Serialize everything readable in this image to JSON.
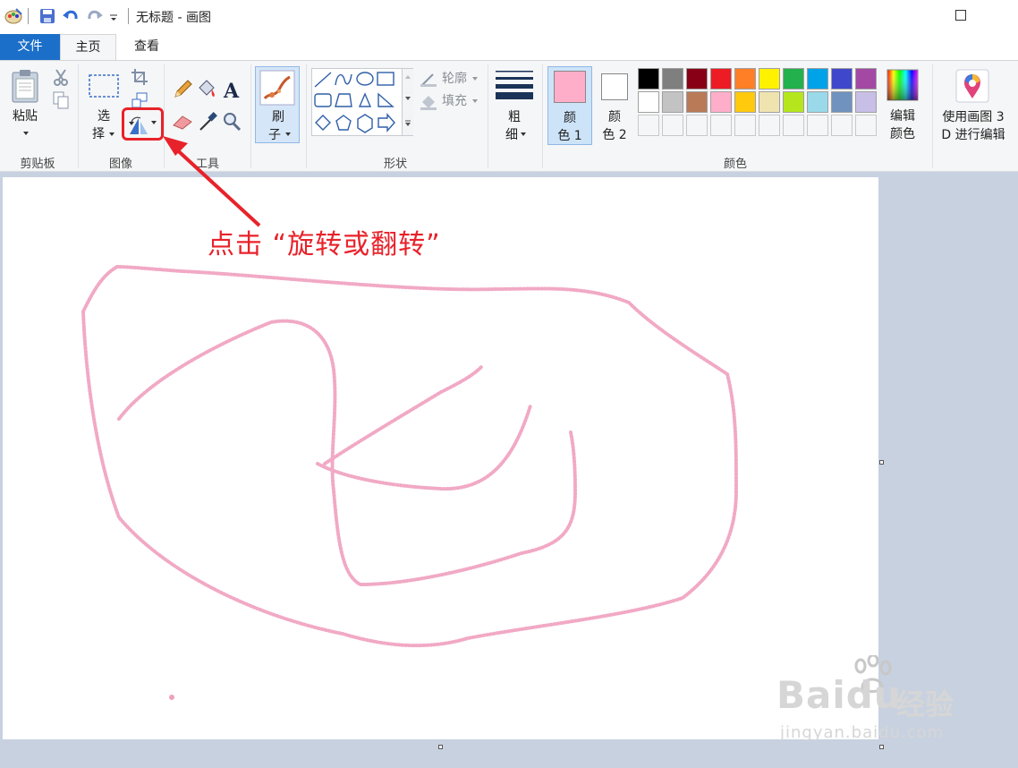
{
  "titlebar": {
    "title": "无标题 - 画图",
    "icons": [
      "paint-app-icon",
      "save-icon",
      "undo-icon",
      "redo-icon",
      "customize-qat-icon",
      "maximize-icon"
    ]
  },
  "tabs": [
    {
      "label": "文件",
      "active": false
    },
    {
      "label": "主页",
      "active": true
    },
    {
      "label": "查看",
      "active": false
    }
  ],
  "ribbon": {
    "clipboard": {
      "paste_label": "粘贴",
      "group_label": "剪贴板",
      "icons": [
        "paste-icon",
        "cut-icon",
        "copy-icon"
      ]
    },
    "image": {
      "select_label_1": "选",
      "select_label_2": "择",
      "group_label": "图像",
      "icons": [
        "select-icon",
        "crop-icon",
        "resize-icon",
        "rotate-icon"
      ]
    },
    "tools": {
      "group_label": "工具",
      "icons": [
        "pencil-icon",
        "fill-icon",
        "text-icon",
        "eraser-icon",
        "color-picker-icon",
        "magnifier-icon"
      ]
    },
    "brushes": {
      "label_1": "刷",
      "label_2": "子"
    },
    "shapes": {
      "group_label": "形状",
      "outline_label": "轮廓",
      "fill_label": "填充"
    },
    "size": {
      "label_1": "粗",
      "label_2": "细"
    },
    "colors": {
      "color1_label_1": "颜",
      "color1_label_2": "色 1",
      "color2_label_1": "颜",
      "color2_label_2": "色 2",
      "edit_label_1": "编辑",
      "edit_label_2": "颜色",
      "group_label": "颜色",
      "color1_value": "#ffaec9",
      "color2_value": "#ffffff",
      "palette_row1": [
        "#000000",
        "#7f7f7f",
        "#880015",
        "#ed1c24",
        "#ff7f27",
        "#fff200",
        "#22b14c",
        "#00a2e8",
        "#3f48cc",
        "#a349a4"
      ],
      "palette_row2": [
        "#ffffff",
        "#c3c3c3",
        "#b97a57",
        "#ffaec9",
        "#ffc90e",
        "#efe4b0",
        "#b5e61d",
        "#99d9ea",
        "#7092be",
        "#c8bfe7"
      ]
    },
    "paint3d": {
      "label_1": "使用画图 3",
      "label_2": "D 进行编辑"
    }
  },
  "annotation": {
    "text": "点击 “旋转或翻转”",
    "color": "#e8222a"
  },
  "watermark": {
    "brand": "Baidu",
    "suffix": "经验",
    "url": "jingyan.baidu.com"
  },
  "drawing": {
    "stroke_color": "#f0a0bf"
  }
}
